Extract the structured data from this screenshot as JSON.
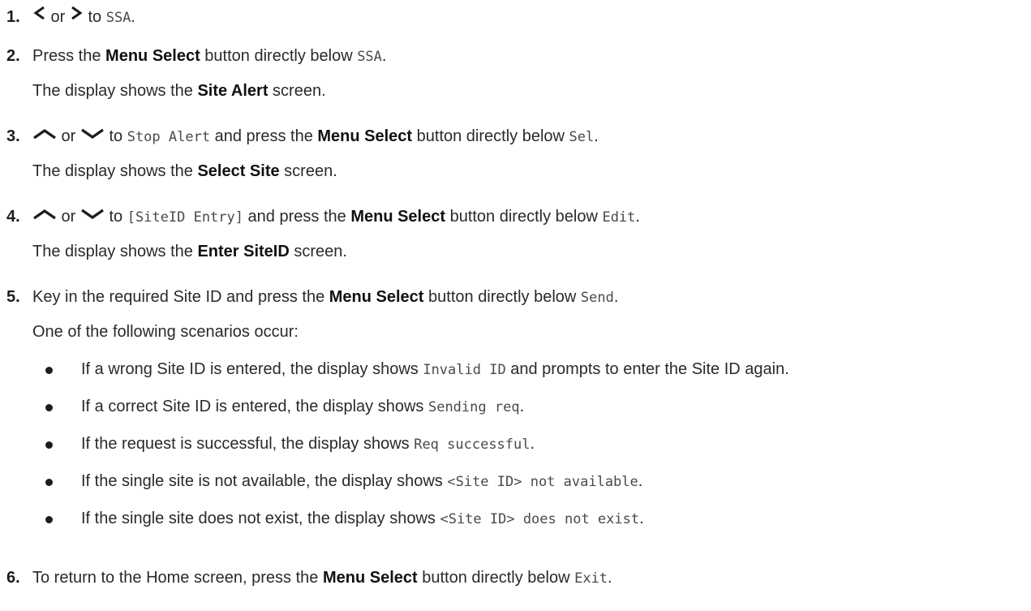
{
  "steps": [
    {
      "num": "1.",
      "parts": [
        {
          "type": "icon",
          "name": "chevron-left-icon"
        },
        {
          "type": "text",
          "value": " or "
        },
        {
          "type": "icon",
          "name": "chevron-right-icon"
        },
        {
          "type": "text",
          "value": " to "
        },
        {
          "type": "mono",
          "value": "SSA"
        },
        {
          "type": "text",
          "value": "."
        }
      ]
    },
    {
      "num": "2.",
      "parts": [
        {
          "type": "text",
          "value": "Press the "
        },
        {
          "type": "bold",
          "value": "Menu Select"
        },
        {
          "type": "text",
          "value": " button directly below "
        },
        {
          "type": "mono",
          "value": "SSA"
        },
        {
          "type": "text",
          "value": "."
        }
      ],
      "result": [
        {
          "type": "text",
          "value": "The display shows the "
        },
        {
          "type": "bold",
          "value": "Site Alert"
        },
        {
          "type": "text",
          "value": " screen."
        }
      ]
    },
    {
      "num": "3.",
      "parts": [
        {
          "type": "icon",
          "name": "chevron-up-icon"
        },
        {
          "type": "text",
          "value": " or "
        },
        {
          "type": "icon",
          "name": "chevron-down-icon"
        },
        {
          "type": "text",
          "value": " to "
        },
        {
          "type": "mono",
          "value": "Stop Alert"
        },
        {
          "type": "text",
          "value": " and press the "
        },
        {
          "type": "bold",
          "value": "Menu Select"
        },
        {
          "type": "text",
          "value": " button directly below "
        },
        {
          "type": "mono",
          "value": "Sel"
        },
        {
          "type": "text",
          "value": "."
        }
      ],
      "result": [
        {
          "type": "text",
          "value": "The display shows the "
        },
        {
          "type": "bold",
          "value": "Select Site"
        },
        {
          "type": "text",
          "value": " screen."
        }
      ]
    },
    {
      "num": "4.",
      "parts": [
        {
          "type": "icon",
          "name": "chevron-up-icon"
        },
        {
          "type": "text",
          "value": " or "
        },
        {
          "type": "icon",
          "name": "chevron-down-icon"
        },
        {
          "type": "text",
          "value": " to "
        },
        {
          "type": "mono",
          "value": "[SiteID Entry]"
        },
        {
          "type": "text",
          "value": " and press the "
        },
        {
          "type": "bold",
          "value": "Menu Select"
        },
        {
          "type": "text",
          "value": " button directly below "
        },
        {
          "type": "mono",
          "value": "Edit"
        },
        {
          "type": "text",
          "value": "."
        }
      ],
      "result": [
        {
          "type": "text",
          "value": "The display shows the "
        },
        {
          "type": "bold",
          "value": "Enter SiteID"
        },
        {
          "type": "text",
          "value": " screen."
        }
      ]
    },
    {
      "num": "5.",
      "parts": [
        {
          "type": "text",
          "value": "Key in the required Site ID and press the "
        },
        {
          "type": "bold",
          "value": "Menu Select"
        },
        {
          "type": "text",
          "value": " button directly below "
        },
        {
          "type": "mono",
          "value": "Send"
        },
        {
          "type": "text",
          "value": "."
        }
      ],
      "result": [
        {
          "type": "text",
          "value": "One of the following scenarios occur:"
        }
      ],
      "bullets": [
        [
          {
            "type": "text",
            "value": "If a wrong Site ID is entered, the display shows "
          },
          {
            "type": "mono",
            "value": "Invalid ID"
          },
          {
            "type": "text",
            "value": " and prompts to enter the Site ID again."
          }
        ],
        [
          {
            "type": "text",
            "value": "If a correct Site ID is entered, the display shows "
          },
          {
            "type": "mono",
            "value": "Sending req"
          },
          {
            "type": "text",
            "value": "."
          }
        ],
        [
          {
            "type": "text",
            "value": "If the request is successful, the display shows "
          },
          {
            "type": "mono",
            "value": "Req successful"
          },
          {
            "type": "text",
            "value": "."
          }
        ],
        [
          {
            "type": "text",
            "value": "If the single site is not available, the display shows "
          },
          {
            "type": "mono",
            "value": "<Site ID> not available"
          },
          {
            "type": "text",
            "value": "."
          }
        ],
        [
          {
            "type": "text",
            "value": "If the single site does not exist, the display shows "
          },
          {
            "type": "mono",
            "value": "<Site ID> does not exist"
          },
          {
            "type": "text",
            "value": "."
          }
        ]
      ]
    },
    {
      "num": "6.",
      "parts": [
        {
          "type": "text",
          "value": "To return to the Home screen, press the "
        },
        {
          "type": "bold",
          "value": "Menu Select"
        },
        {
          "type": "text",
          "value": " button directly below "
        },
        {
          "type": "mono",
          "value": "Exit"
        },
        {
          "type": "text",
          "value": "."
        }
      ]
    }
  ]
}
